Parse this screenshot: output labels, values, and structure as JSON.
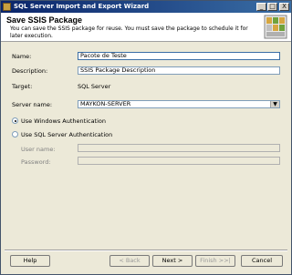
{
  "titlebar": {
    "title": "SQL Server Import and Export Wizard",
    "buttons": {
      "minimize": "_",
      "maximize": "□",
      "close": "X"
    }
  },
  "header": {
    "title": "Save SSIS Package",
    "subtitle": "You can save the SSIS package for reuse. You must save the package to schedule it for later execution."
  },
  "form": {
    "name_label": "Name:",
    "name_value": "Pacote de Teste",
    "description_label": "Description:",
    "description_value": "SSIS Package Description",
    "target_label": "Target:",
    "target_value": "SQL Server",
    "server_name_label": "Server name:",
    "server_name_value": "MAYKON-SERVER",
    "auth_windows_label": "Use Windows Authentication",
    "auth_sql_label": "Use SQL Server Authentication",
    "auth_selected": "windows",
    "username_label": "User name:",
    "password_label": "Password:"
  },
  "footer": {
    "help": "Help",
    "back": "< Back",
    "next": "Next >",
    "finish": "Finish >>|",
    "cancel": "Cancel"
  }
}
